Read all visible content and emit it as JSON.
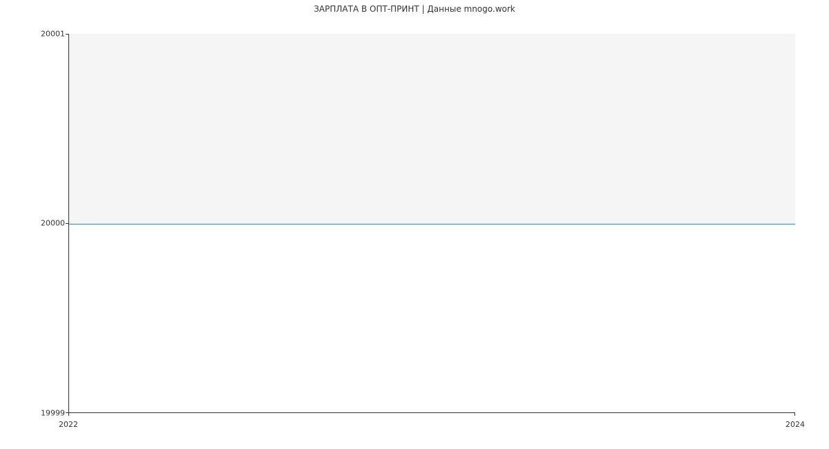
{
  "chart_data": {
    "type": "line",
    "title": "ЗАРПЛАТА В  ОПТ-ПРИНТ | Данные mnogo.work",
    "xlabel": "",
    "ylabel": "",
    "x": [
      2022,
      2024
    ],
    "values": [
      20000,
      20000
    ],
    "xlim": [
      2022,
      2024
    ],
    "ylim": [
      19999,
      20001
    ],
    "x_ticks": [
      "2022",
      "2024"
    ],
    "y_ticks": [
      "20001",
      "20000",
      "19999"
    ]
  }
}
